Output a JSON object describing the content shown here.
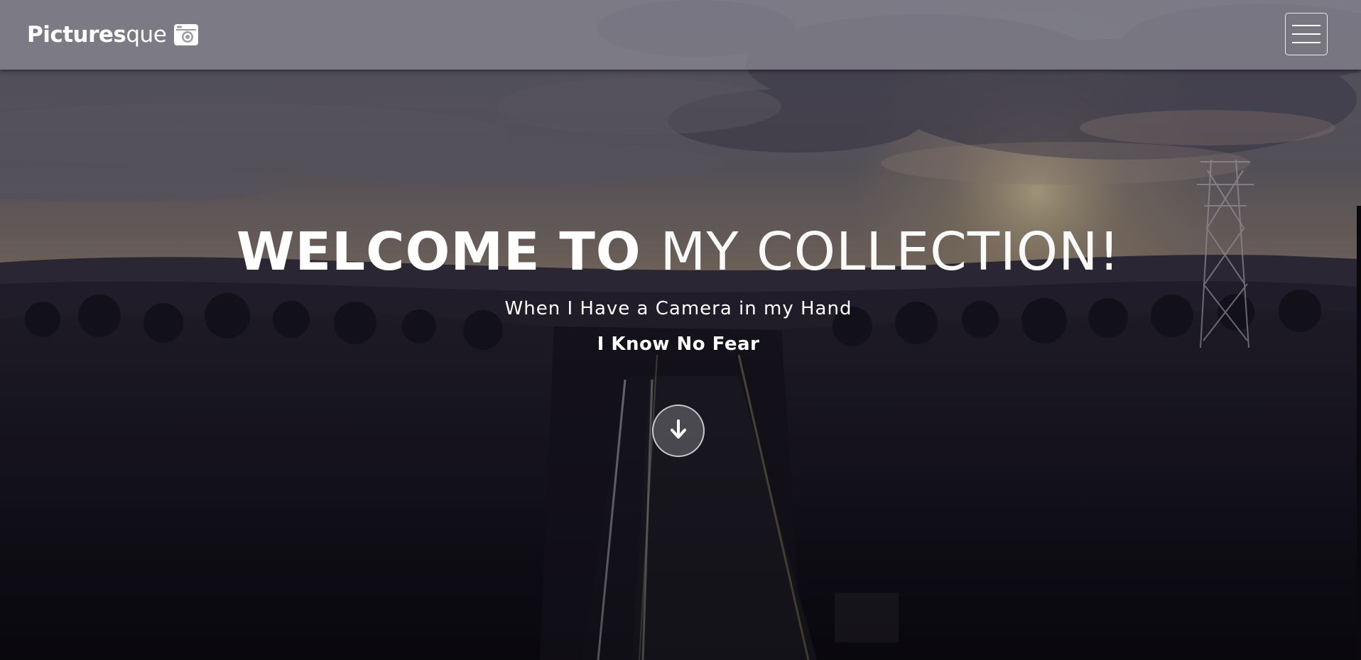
{
  "brand": {
    "bold": "Pictures",
    "light": "que",
    "icon": "camera-icon"
  },
  "nav": {
    "menu_icon": "hamburger-icon"
  },
  "hero": {
    "title_strong": "WELCOME TO",
    "title_thin": "MY COLLECTION!",
    "subtitle": "When I Have a Camera in my Hand",
    "tagline": "I Know No Fear",
    "scroll_icon": "arrow-down-icon"
  },
  "colors": {
    "navbar": "#9696a0",
    "text": "#ffffff",
    "sky_top": "#5f5f6e",
    "sunset": "#b9a483",
    "forest": "#141220"
  }
}
